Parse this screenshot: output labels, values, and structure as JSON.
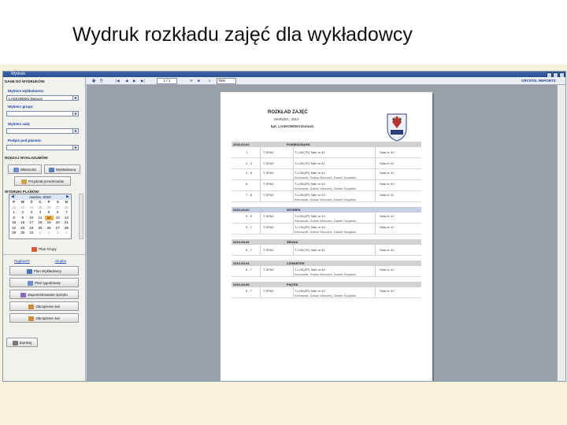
{
  "slide": {
    "title": "Wydruk rozkładu zajęć dla wykładowcy"
  },
  "window": {
    "title": "Wydruki"
  },
  "left": {
    "data_section": "DANE DO WYDRUKÓW:",
    "lecturer_label": "Wybierz wykładowcę:",
    "lecturer_value": "LASKOWSKI Dariusz",
    "group_label": "Wybierz grupę:",
    "room_label": "Wybierz salę:",
    "plan_label": "Podpis pod planem:",
    "reports_section": "RODZAJ WYKŁADUMÓW:",
    "btn_wlasnosci": "Własności",
    "btn_wykladowca": "Wykładowca",
    "btn_przydzial": "Przydział przedmiotów",
    "plans_section": "WYDRUKI PLANÓW:",
    "calendar": {
      "month": "marzec, 2010",
      "days_header": [
        "P",
        "W",
        "Ś",
        "C",
        "P",
        "S",
        "N"
      ],
      "rows": [
        [
          "22",
          "23",
          "24",
          "25",
          "26",
          "27",
          "28"
        ],
        [
          "1",
          "2",
          "3",
          "4",
          "5",
          "6",
          "7"
        ],
        [
          "8",
          "9",
          "10",
          "11",
          "12",
          "13",
          "14"
        ],
        [
          "15",
          "16",
          "17",
          "18",
          "19",
          "20",
          "21"
        ],
        [
          "22",
          "23",
          "24",
          "25",
          "26",
          "27",
          "28"
        ],
        [
          "29",
          "30",
          "31",
          "1",
          "2",
          "3",
          "4"
        ]
      ],
      "selected": "12"
    },
    "btn_plan_grupy": "Plan Grupy",
    "link_naglowek": "Nagłówek",
    "link_stopka": "Stopka",
    "btn_plan_wykladowcy": "Plan Wykładowcy",
    "btn_plan_tygodniowy": "Plan tygodniowy",
    "btn_zapotrzebowanie": "Zapotrzebowanie sprzętu",
    "btn_obciazenie1": "Obciążenie Sal",
    "btn_obciazenie2": "Obciążenie Sal",
    "btn_zamknij": "Zamknij"
  },
  "toolbar": {
    "page_value": "1 / 1",
    "zoom": "75%",
    "brand": "CRYSTAL REPORTS"
  },
  "report": {
    "title": "ROZKŁAD ZAJĘĆ",
    "month": "MARZEC, 2010",
    "lecturer": "kpt. LASKOWSKI Dariusz",
    "days": [
      {
        "date": "2010-03-01",
        "day": "PONIEDZIAŁEK",
        "highlight": false,
        "rows": [
          {
            "hours": "1",
            "type": "T-SPAZ",
            "subject": "T-LOK(TE) Sale nr 41",
            "room": "Sala nr 41"
          },
          {
            "hours": "2 - 3",
            "type": "T-SPAZ",
            "subject": "T-LOK(TE) Sale nr 41",
            "room": "Sala nr 41"
          },
          {
            "hours": "4 - 5",
            "type": "T-SPAZ",
            "subject": "T-LOK(ZP) Sale nr 44",
            "room": "Sala nr 41",
            "sub": "Kierownik: Doktor Mroczek, Daniel Socjalski"
          },
          {
            "hours": "6",
            "type": "T-SPAZ",
            "subject": "T-LOK(ZP) Sale nr 44",
            "room": "Sala nr 41",
            "sub": "Kierownik: Doktor Mroczek, Daniel Socjalski"
          },
          {
            "hours": "7 - 8",
            "type": "T-SPAZ",
            "subject": "T-LOK(ZP) Sale nr 44",
            "room": "Sala nr 41",
            "sub": "Kierownik: Doktor Mroczek, Daniel Socjalski"
          }
        ]
      },
      {
        "date": "2010-03-02",
        "day": "WTOREK",
        "highlight": true,
        "rows": [
          {
            "hours": "5 - 6",
            "type": "T-SPAZ",
            "subject": "T-LOK(ZP) Sale nr 44",
            "room": "Sala nr 41",
            "sub": "Kierownik: Doktor Mroczek, Daniel Socjalski"
          },
          {
            "hours": "5 - 7",
            "type": "T-SPAZ",
            "subject": "T-LOK(ZP) Sale nr 44",
            "room": "Sala nr 41",
            "sub": "Kierownik: Doktor Mroczek, Daniel Socjalski"
          }
        ]
      },
      {
        "date": "2010-03-03",
        "day": "ŚRODA",
        "highlight": false,
        "rows": [
          {
            "hours": "6 - 7",
            "type": "T-SPAZ",
            "subject": "T-LOK(TE) Sale nr 41",
            "room": "Sala nr 41"
          }
        ]
      },
      {
        "date": "2010-03-04",
        "day": "CZWARTEK",
        "highlight": false,
        "rows": [
          {
            "hours": "6 - 7",
            "type": "T-SPAZ",
            "subject": "T-LOK(ZP) Sale nr 44",
            "room": "Sala nr 41",
            "sub": "Kierownik: Doktor Mroczek, Daniel Socjalski"
          }
        ]
      },
      {
        "date": "2010-03-05",
        "day": "PIĄTEK",
        "highlight": false,
        "rows": [
          {
            "hours": "6 - 7",
            "type": "T-SPAZ",
            "subject": "T-LOK(ZP) Sale nr 44",
            "room": "Sala nr 41",
            "sub": "Kierownik: Doktor Mroczek, Daniel Socjalski"
          }
        ]
      }
    ]
  }
}
